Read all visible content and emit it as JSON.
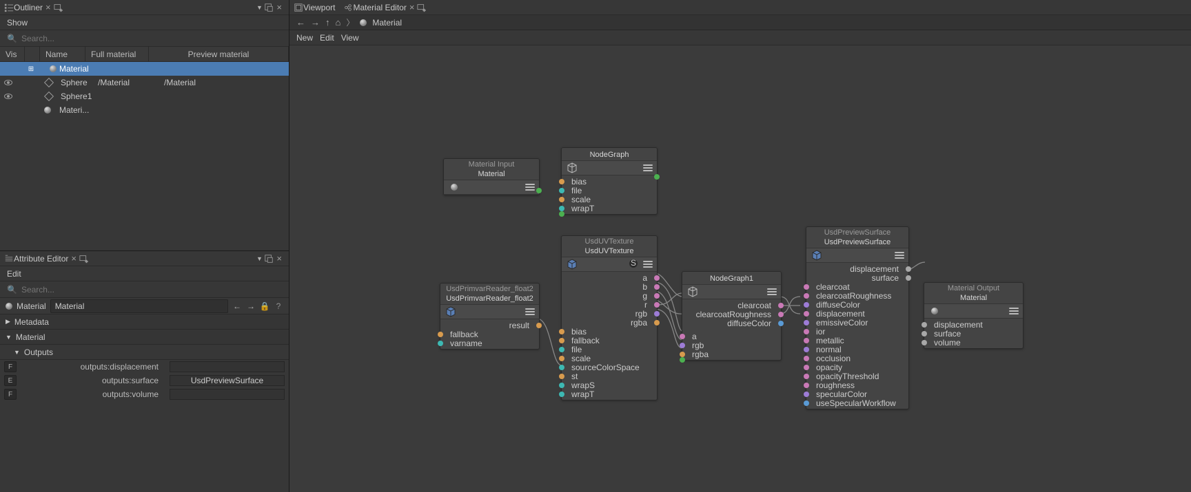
{
  "outliner": {
    "title": "Outliner",
    "menu_show": "Show",
    "search_placeholder": "Search...",
    "columns": {
      "vis": "Vis",
      "name": "Name",
      "full": "Full material",
      "preview": "Preview material"
    },
    "rows": [
      {
        "name": "Material",
        "selected": true,
        "type": "material",
        "expand": "+"
      },
      {
        "name": "Sphere",
        "full": "/Material",
        "preview": "/Material",
        "type": "mesh",
        "vis": true
      },
      {
        "name": "Sphere1",
        "type": "mesh",
        "vis": true
      },
      {
        "name": "Materi...",
        "type": "material"
      }
    ]
  },
  "attr": {
    "title": "Attribute Editor",
    "menu_edit": "Edit",
    "search_placeholder": "Search...",
    "breadcrumb_label": "Material",
    "breadcrumb_value": "Material",
    "sections": {
      "metadata": "Metadata",
      "material": "Material",
      "outputs": "Outputs"
    },
    "rows": [
      {
        "badge": "F",
        "key": "outputs:displacement",
        "val": ""
      },
      {
        "badge": "E",
        "key": "outputs:surface",
        "val": "UsdPreviewSurface"
      },
      {
        "badge": "F",
        "key": "outputs:volume",
        "val": ""
      }
    ]
  },
  "tabs": {
    "viewport": "Viewport",
    "material_editor": "Material Editor"
  },
  "crumb": {
    "root": "Material",
    "menu": [
      "New",
      "Edit",
      "View"
    ]
  },
  "nodes": {
    "matInput": {
      "head": "Material Input",
      "sub": "Material"
    },
    "nodegraph": {
      "head": "",
      "sub": "NodeGraph",
      "ins": [
        "bias",
        "file",
        "scale",
        "wrapT"
      ]
    },
    "primvar": {
      "head": "UsdPrimvarReader_float2",
      "sub": "UsdPrimvarReader_float2",
      "ins": [
        "fallback",
        "varname"
      ],
      "outs": [
        "result"
      ]
    },
    "uvtex": {
      "head": "UsdUVTexture",
      "sub": "UsdUVTexture",
      "ins": [
        "bias",
        "fallback",
        "file",
        "scale",
        "sourceColorSpace",
        "st",
        "wrapS",
        "wrapT"
      ],
      "outs": [
        "a",
        "b",
        "g",
        "r",
        "rgb",
        "rgba"
      ]
    },
    "ng1": {
      "head": "",
      "sub": "NodeGraph1",
      "ins": [
        "clearcoat",
        "clearcoatRoughness",
        "diffuseColor"
      ],
      "outs": [
        "a",
        "rgb",
        "rgba"
      ]
    },
    "preview": {
      "head": "UsdPreviewSurface",
      "sub": "UsdPreviewSurface",
      "outs": [
        "displacement",
        "surface"
      ],
      "ins": [
        "clearcoat",
        "clearcoatRoughness",
        "diffuseColor",
        "displacement",
        "emissiveColor",
        "ior",
        "metallic",
        "normal",
        "occlusion",
        "opacity",
        "opacityThreshold",
        "roughness",
        "specularColor",
        "useSpecularWorkflow"
      ]
    },
    "matOutput": {
      "head": "Material Output",
      "sub": "Material",
      "ins": [
        "displacement",
        "surface",
        "volume"
      ]
    }
  }
}
